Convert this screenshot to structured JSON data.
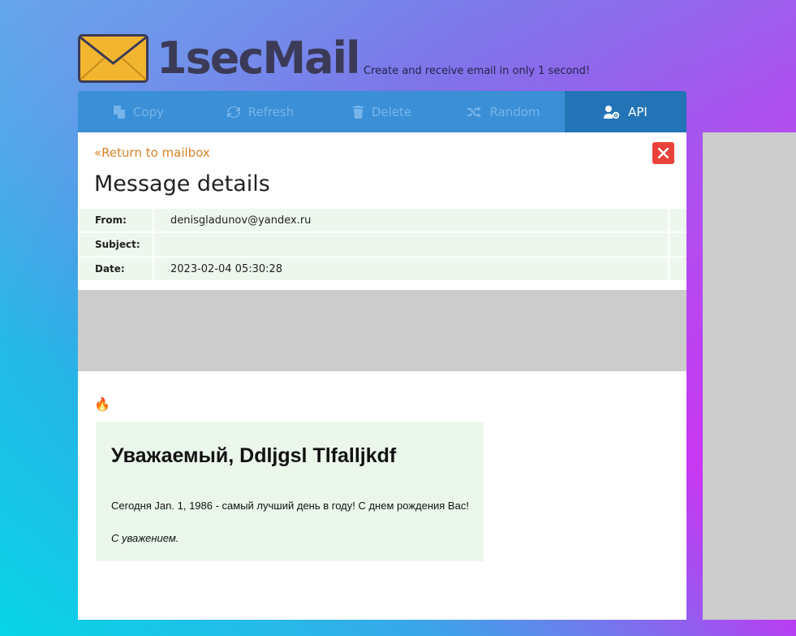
{
  "brand": {
    "name": "1secMail",
    "tagline": "Create and receive email in only 1 second!",
    "icon": "envelope-icon"
  },
  "toolbar": {
    "buttons": [
      {
        "label": "Copy",
        "icon": "copy-icon"
      },
      {
        "label": "Refresh",
        "icon": "refresh-icon"
      },
      {
        "label": "Delete",
        "icon": "trash-icon"
      },
      {
        "label": "Random",
        "icon": "shuffle-icon"
      },
      {
        "label": "API",
        "icon": "user-gear-icon",
        "active": true
      }
    ]
  },
  "message": {
    "return_link": "«Return to mailbox",
    "title": "Message details",
    "from_label": "From:",
    "from_value": "denisgladunov@yandex.ru",
    "subject_label": "Subject:",
    "subject_value": "",
    "date_label": "Date:",
    "date_value": "2023-02-04 05:30:28",
    "fire_emoji": "🔥",
    "greeting": "Уважаемый, Ddljgsl Tlfalljkdf",
    "body_text": "Сегодня Jan. 1, 1986 - самый лучший день в году! С днем рождения Вас!",
    "signature": "С уважением."
  },
  "colors": {
    "toolbar_bg": "#3a8fd6",
    "toolbar_active": "#2274b6",
    "link": "#d9822b",
    "close": "#e8423a",
    "meta_bg": "#eef7ee"
  }
}
